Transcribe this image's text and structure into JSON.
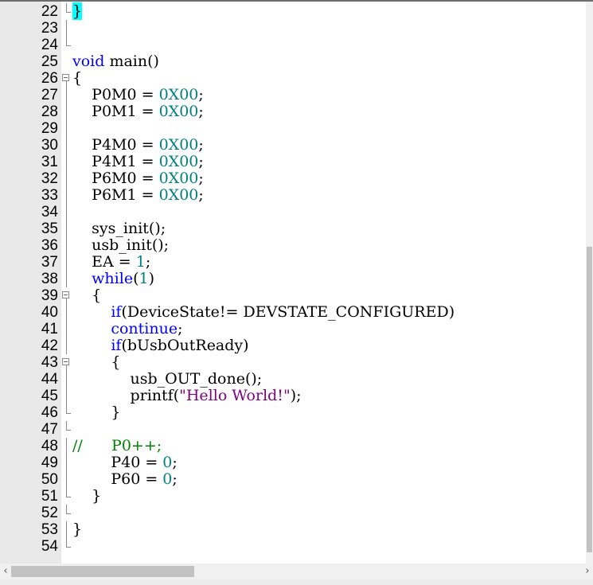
{
  "editor": {
    "lines": [
      {
        "n": "22",
        "fold": "end",
        "seg": [
          {
            "t": "}",
            "c": "hl"
          }
        ]
      },
      {
        "n": "23",
        "fold": "line",
        "seg": []
      },
      {
        "n": "24",
        "fold": "end",
        "seg": []
      },
      {
        "n": "25",
        "fold": "none",
        "seg": [
          {
            "t": "void",
            "c": "kw"
          },
          {
            "t": " main()",
            "c": ""
          }
        ]
      },
      {
        "n": "26",
        "fold": "box",
        "seg": [
          {
            "t": "{",
            "c": ""
          }
        ]
      },
      {
        "n": "27",
        "fold": "line",
        "seg": [
          {
            "t": "    P0M0 = ",
            "c": ""
          },
          {
            "t": "0X00",
            "c": "num"
          },
          {
            "t": ";",
            "c": ""
          }
        ]
      },
      {
        "n": "28",
        "fold": "line",
        "seg": [
          {
            "t": "    P0M1 = ",
            "c": ""
          },
          {
            "t": "0X00",
            "c": "num"
          },
          {
            "t": ";",
            "c": ""
          }
        ]
      },
      {
        "n": "29",
        "fold": "line",
        "seg": []
      },
      {
        "n": "30",
        "fold": "line",
        "seg": [
          {
            "t": "    P4M0 = ",
            "c": ""
          },
          {
            "t": "0X00",
            "c": "num"
          },
          {
            "t": ";",
            "c": ""
          }
        ]
      },
      {
        "n": "31",
        "fold": "line",
        "seg": [
          {
            "t": "    P4M1 = ",
            "c": ""
          },
          {
            "t": "0X00",
            "c": "num"
          },
          {
            "t": ";",
            "c": ""
          }
        ]
      },
      {
        "n": "32",
        "fold": "line",
        "seg": [
          {
            "t": "    P6M0 = ",
            "c": ""
          },
          {
            "t": "0X00",
            "c": "num"
          },
          {
            "t": ";",
            "c": ""
          }
        ]
      },
      {
        "n": "33",
        "fold": "line",
        "seg": [
          {
            "t": "    P6M1 = ",
            "c": ""
          },
          {
            "t": "0X00",
            "c": "num"
          },
          {
            "t": ";",
            "c": ""
          }
        ]
      },
      {
        "n": "34",
        "fold": "line",
        "seg": []
      },
      {
        "n": "35",
        "fold": "line",
        "seg": [
          {
            "t": "    sys_init();",
            "c": ""
          }
        ]
      },
      {
        "n": "36",
        "fold": "line",
        "seg": [
          {
            "t": "    usb_init();",
            "c": ""
          }
        ]
      },
      {
        "n": "37",
        "fold": "line",
        "seg": [
          {
            "t": "    EA = ",
            "c": ""
          },
          {
            "t": "1",
            "c": "num"
          },
          {
            "t": ";",
            "c": ""
          }
        ]
      },
      {
        "n": "38",
        "fold": "line",
        "seg": [
          {
            "t": "    ",
            "c": ""
          },
          {
            "t": "while",
            "c": "kw"
          },
          {
            "t": "(",
            "c": ""
          },
          {
            "t": "1",
            "c": "num"
          },
          {
            "t": ")",
            "c": ""
          }
        ]
      },
      {
        "n": "39",
        "fold": "box",
        "seg": [
          {
            "t": "    {",
            "c": ""
          }
        ]
      },
      {
        "n": "40",
        "fold": "line",
        "seg": [
          {
            "t": "        ",
            "c": ""
          },
          {
            "t": "if",
            "c": "kw"
          },
          {
            "t": "(DeviceState!= DEVSTATE_CONFIGURED)",
            "c": ""
          }
        ]
      },
      {
        "n": "41",
        "fold": "line",
        "seg": [
          {
            "t": "        ",
            "c": ""
          },
          {
            "t": "continue",
            "c": "kw"
          },
          {
            "t": ";",
            "c": ""
          }
        ]
      },
      {
        "n": "42",
        "fold": "line",
        "seg": [
          {
            "t": "        ",
            "c": ""
          },
          {
            "t": "if",
            "c": "kw"
          },
          {
            "t": "(bUsbOutReady)",
            "c": ""
          }
        ]
      },
      {
        "n": "43",
        "fold": "box",
        "seg": [
          {
            "t": "        {",
            "c": ""
          }
        ]
      },
      {
        "n": "44",
        "fold": "line",
        "seg": [
          {
            "t": "            usb_OUT_done();",
            "c": ""
          }
        ]
      },
      {
        "n": "45",
        "fold": "line",
        "seg": [
          {
            "t": "            printf(",
            "c": ""
          },
          {
            "t": "\"Hello World!\"",
            "c": "str"
          },
          {
            "t": ");",
            "c": ""
          }
        ]
      },
      {
        "n": "46",
        "fold": "end",
        "seg": [
          {
            "t": "        }",
            "c": ""
          }
        ]
      },
      {
        "n": "47",
        "fold": "end",
        "seg": []
      },
      {
        "n": "48",
        "fold": "line",
        "seg": [
          {
            "t": "//      P0++;",
            "c": "cmt"
          }
        ]
      },
      {
        "n": "49",
        "fold": "line",
        "seg": [
          {
            "t": "        P40 = ",
            "c": ""
          },
          {
            "t": "0",
            "c": "num"
          },
          {
            "t": ";",
            "c": ""
          }
        ]
      },
      {
        "n": "50",
        "fold": "line",
        "seg": [
          {
            "t": "        P60 = ",
            "c": ""
          },
          {
            "t": "0",
            "c": "num"
          },
          {
            "t": ";",
            "c": ""
          }
        ]
      },
      {
        "n": "51",
        "fold": "end",
        "seg": [
          {
            "t": "    }",
            "c": ""
          }
        ]
      },
      {
        "n": "52",
        "fold": "end",
        "seg": []
      },
      {
        "n": "53",
        "fold": "line",
        "seg": [
          {
            "t": "}",
            "c": ""
          }
        ]
      },
      {
        "n": "54",
        "fold": "end",
        "seg": []
      }
    ]
  },
  "scrollbars": {
    "horizontal": {
      "left_arrow": "‹",
      "right_arrow": "›"
    }
  },
  "colors": {
    "keyword": "#0000ff",
    "number": "#008080",
    "string": "#800080",
    "comment": "#008000",
    "brace_highlight": "#00ffff",
    "gutter": "#e9e9e9"
  },
  "icons": {
    "fold_box": "fold-collapse-icon",
    "left_arrow": "scroll-left-arrow-icon",
    "right_arrow": "scroll-right-arrow-icon"
  }
}
